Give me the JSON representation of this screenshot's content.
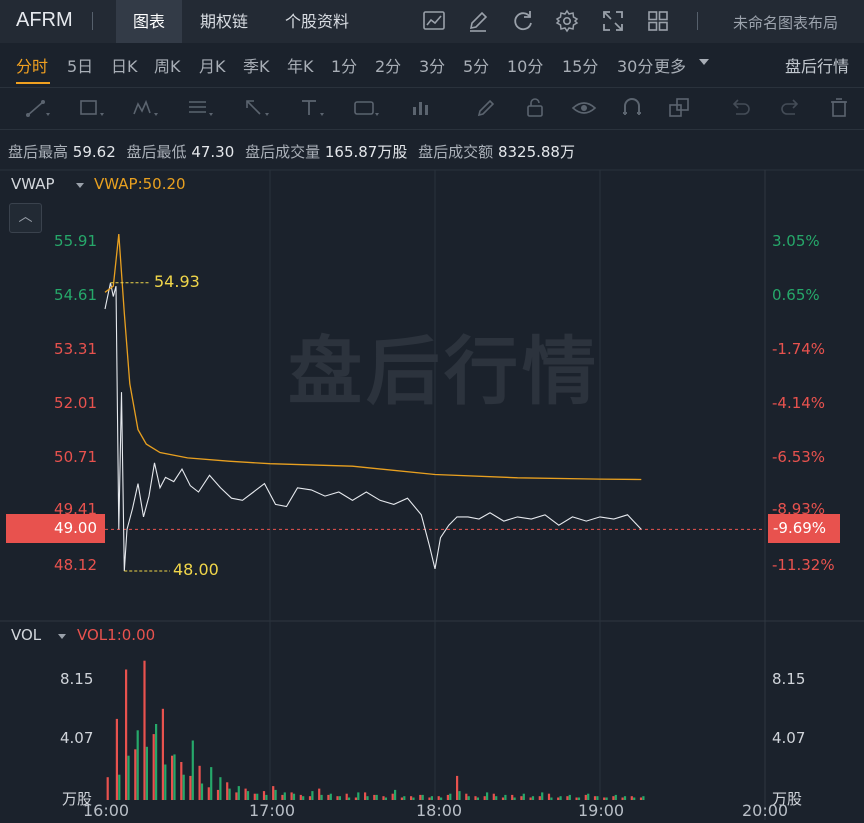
{
  "header": {
    "symbol": "AFRM",
    "tabs": [
      {
        "label": "图表",
        "active": true
      },
      {
        "label": "期权链",
        "active": false
      },
      {
        "label": "个股资料",
        "active": false
      }
    ],
    "icons": [
      "line-chart-icon",
      "pencil-icon",
      "refresh-icon",
      "gear-icon",
      "fullscreen-icon",
      "grid-layout-icon"
    ],
    "layout_name": "未命名图表布局"
  },
  "periods": {
    "items": [
      "分时",
      "5日",
      "日K",
      "周K",
      "月K",
      "季K",
      "年K",
      "1分",
      "2分",
      "3分",
      "5分",
      "10分",
      "15分",
      "30分"
    ],
    "active": "分时",
    "more_label": "更多",
    "after_hours_label": "盘后行情"
  },
  "drawing_tools": [
    "trend-line-icon",
    "rectangle-icon",
    "pattern-icon",
    "fibonacci-icon",
    "arrow-icon",
    "text-icon",
    "label-icon",
    "volume-profile-icon",
    "brush-icon",
    "lock-icon",
    "eye-icon",
    "magnet-icon",
    "layers-icon",
    "undo-icon",
    "redo-icon",
    "trash-icon"
  ],
  "stats": {
    "high_label": "盘后最高",
    "high_value": "59.62",
    "low_label": "盘后最低",
    "low_value": "47.30",
    "volume_label": "盘后成交量",
    "volume_value": "165.87万股",
    "turnover_label": "盘后成交额",
    "turnover_value": "8325.88万"
  },
  "main_panel": {
    "indicator_name": "VWAP",
    "indicator_value": "VWAP:50.20",
    "watermark": "盘后行情",
    "price_ticks": [
      "55.91",
      "54.61",
      "53.31",
      "52.01",
      "50.71",
      "49.41",
      "48.12"
    ],
    "percent_ticks": [
      "3.05%",
      "0.65%",
      "-1.74%",
      "-4.14%",
      "-6.53%",
      "-8.93%",
      "-11.32%"
    ],
    "current_price": "49.00",
    "current_percent": "-9.69%",
    "high_marker": "54.93",
    "low_marker": "48.00"
  },
  "volume_panel": {
    "indicator_name": "VOL",
    "indicator_value": "VOL1:0.00",
    "ticks": [
      "8.15",
      "4.07"
    ],
    "unit": "万股"
  },
  "time_axis": [
    "16:00",
    "17:00",
    "18:00",
    "19:00",
    "20:00"
  ],
  "colors": {
    "up": "#26a86a",
    "down": "#e8524e",
    "vwap": "#e8a020",
    "price_line": "#e6e9ee",
    "accent": "#f0a020",
    "marker": "#f0d64a"
  },
  "chart_data": [
    {
      "type": "line",
      "x_range": [
        "16:00",
        "20:00"
      ],
      "ylim": [
        47.8,
        56.5
      ],
      "series": [
        {
          "name": "VWAP",
          "x": [
            "16:00",
            "16:03",
            "16:05",
            "16:07",
            "16:09",
            "16:12",
            "16:15",
            "16:20",
            "16:30",
            "16:45",
            "17:00",
            "17:30",
            "18:00",
            "18:30",
            "19:00",
            "19:15"
          ],
          "values": [
            54.7,
            54.85,
            56.1,
            54.2,
            52.5,
            51.4,
            51.05,
            50.85,
            50.72,
            50.64,
            50.58,
            50.52,
            50.32,
            50.24,
            50.21,
            50.2
          ]
        },
        {
          "x": [
            "16:00",
            "16:02",
            "16:03",
            "16:04",
            "16:05",
            "16:06",
            "16:07",
            "16:08",
            "16:10",
            "16:12",
            "16:14",
            "16:16",
            "16:18",
            "16:20",
            "16:22",
            "16:25",
            "16:28",
            "16:31",
            "16:34",
            "16:38",
            "16:42",
            "16:46",
            "16:50",
            "16:54",
            "16:58",
            "17:02",
            "17:06",
            "17:10",
            "17:15",
            "17:20",
            "17:25",
            "17:30",
            "17:35",
            "17:40",
            "17:45",
            "17:50",
            "17:55",
            "17:58",
            "18:00",
            "18:02",
            "18:05",
            "18:08",
            "18:12",
            "18:16",
            "18:20",
            "18:25",
            "18:30",
            "18:35",
            "18:40",
            "18:45",
            "18:50",
            "18:55",
            "19:00",
            "19:05",
            "19:10",
            "19:15"
          ],
          "values": [
            54.3,
            54.93,
            54.6,
            54.85,
            49.0,
            52.3,
            48.0,
            49.0,
            49.5,
            50.1,
            49.3,
            49.8,
            50.6,
            50.0,
            50.25,
            50.15,
            50.45,
            50.05,
            49.9,
            50.3,
            50.0,
            49.75,
            49.7,
            49.9,
            50.1,
            49.6,
            49.55,
            50.0,
            49.95,
            49.8,
            49.9,
            49.7,
            49.9,
            49.7,
            49.6,
            49.75,
            49.35,
            48.6,
            48.05,
            48.8,
            49.1,
            49.3,
            49.3,
            49.25,
            49.4,
            49.2,
            49.3,
            49.25,
            49.35,
            49.1,
            49.3,
            49.2,
            49.3,
            49.25,
            49.35,
            49.0
          ]
        }
      ]
    },
    {
      "type": "bar",
      "ylim": [
        0,
        12
      ],
      "x_range": [
        "16:00",
        "20:00"
      ],
      "up_values": [
        0,
        2.0,
        3.5,
        5.5,
        4.2,
        6.0,
        2.8,
        3.6,
        2.0,
        4.7,
        1.3,
        2.6,
        1.8,
        0.9,
        1.1,
        0.7,
        0.5,
        0.4,
        0.8,
        0.6,
        0.5,
        0.3,
        0.7,
        0.4,
        0.5,
        0.3,
        0.2,
        0.6,
        0.3,
        0.4,
        0.2,
        0.8,
        0.3,
        0.2,
        0.4,
        0.3,
        0.2,
        0.5,
        0.7,
        0.3,
        0.2,
        0.6,
        0.3,
        0.4,
        0.2,
        0.5,
        0.3,
        0.6,
        0.2,
        0.3,
        0.4,
        0.2,
        0.5,
        0.3,
        0.2,
        0.4,
        0.3,
        0.2,
        0.3
      ],
      "down_values": [
        1.8,
        6.4,
        10.3,
        4.0,
        11.0,
        5.2,
        7.2,
        3.5,
        3.0,
        1.9,
        2.7,
        1.0,
        0.8,
        1.4,
        0.6,
        0.9,
        0.5,
        0.7,
        1.1,
        0.4,
        0.6,
        0.4,
        0.3,
        0.9,
        0.4,
        0.3,
        0.5,
        0.2,
        0.6,
        0.4,
        0.3,
        0.5,
        0.2,
        0.3,
        0.4,
        0.2,
        0.3,
        0.4,
        1.9,
        0.5,
        0.3,
        0.3,
        0.5,
        0.2,
        0.4,
        0.3,
        0.2,
        0.3,
        0.5,
        0.2,
        0.3,
        0.2,
        0.4,
        0.3,
        0.2,
        0.3,
        0.2,
        0.3,
        0.2
      ]
    }
  ]
}
